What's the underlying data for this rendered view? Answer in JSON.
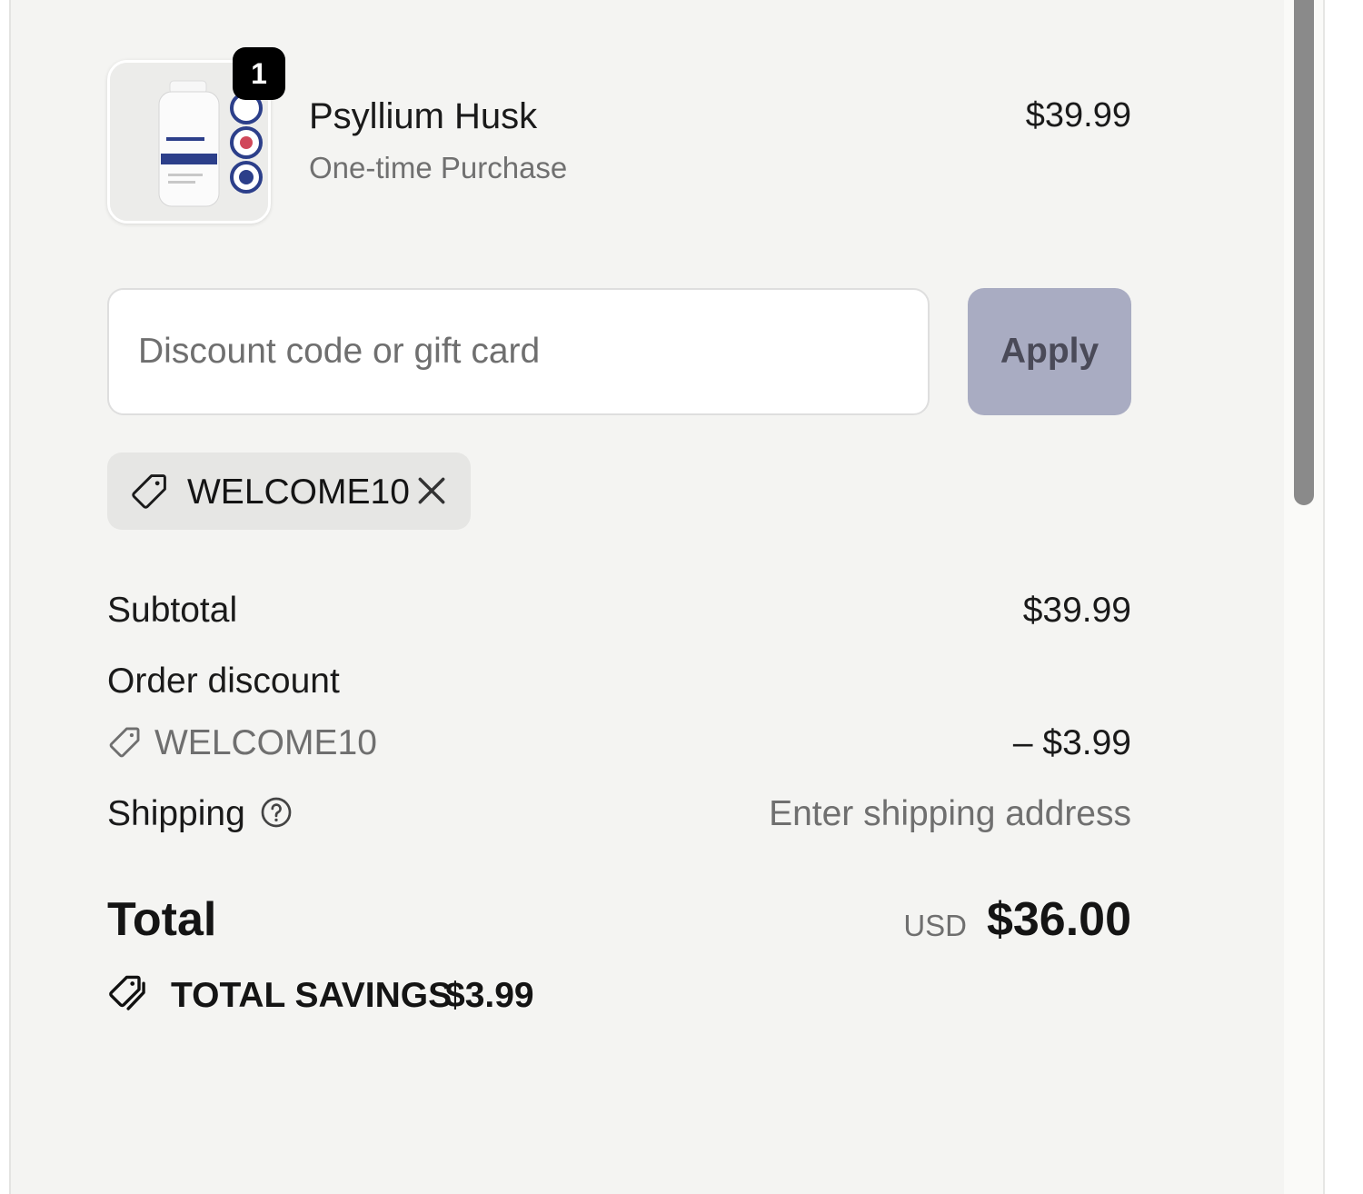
{
  "line_item": {
    "quantity": "1",
    "name": "Psyllium Husk",
    "purchase_type": "One-time Purchase",
    "price": "$39.99"
  },
  "discount": {
    "placeholder": "Discount code or gift card",
    "value": "",
    "apply_label": "Apply",
    "applied_code": "WELCOME10"
  },
  "summary": {
    "subtotal_label": "Subtotal",
    "subtotal_value": "$39.99",
    "order_discount_label": "Order discount",
    "discount_code": "WELCOME10",
    "discount_value": "– $3.99",
    "shipping_label": "Shipping",
    "shipping_value": "Enter shipping address",
    "total_label": "Total",
    "currency": "USD",
    "total_value": "$36.00",
    "savings_label": "TOTAL SAVINGS",
    "savings_value": "$3.99"
  },
  "icons": {
    "tag": "tag-icon",
    "close": "close-icon",
    "help": "help-circle-icon",
    "savings": "double-tag-icon"
  },
  "colors": {
    "panel_bg": "#f4f4f2",
    "apply_button_bg": "#a9acc2",
    "muted_text": "#6f6f6f"
  }
}
